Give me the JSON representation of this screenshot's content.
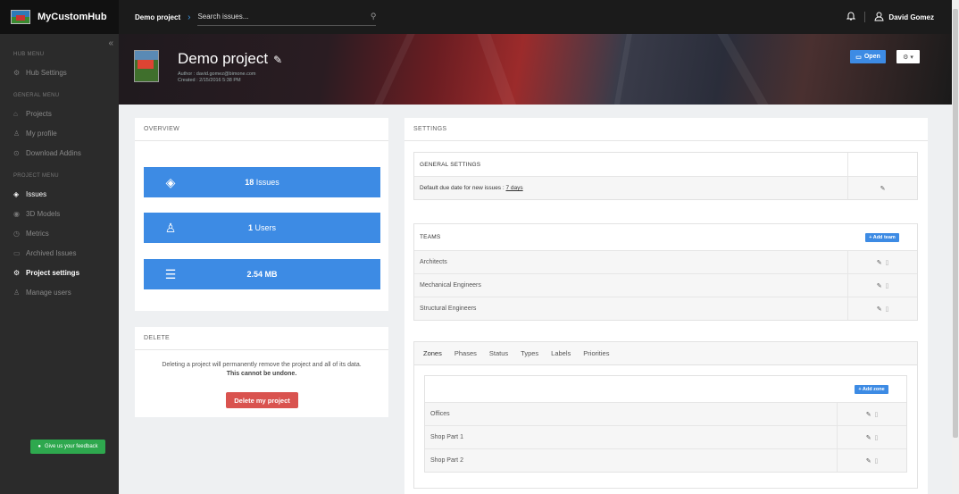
{
  "app": {
    "name": "MyCustomHub"
  },
  "topbar": {
    "breadcrumb": "Demo project",
    "breadcrumb_arrow": "›",
    "search_placeholder": "Search issues...",
    "user_name": "David Gomez"
  },
  "sidebar": {
    "collapse_glyph": "«",
    "sections": [
      {
        "title": "HUB MENU",
        "items": [
          {
            "label": "Hub Settings",
            "icon": "gear-icon",
            "glyph": "⚙",
            "active": false
          }
        ]
      },
      {
        "title": "GENERAL MENU",
        "items": [
          {
            "label": "Projects",
            "icon": "home-icon",
            "glyph": "⌂",
            "active": false
          },
          {
            "label": "My profile",
            "icon": "user-icon",
            "glyph": "♙",
            "active": false
          },
          {
            "label": "Download Addins",
            "icon": "download-icon",
            "glyph": "⊙",
            "active": false
          }
        ]
      },
      {
        "title": "PROJECT MENU",
        "items": [
          {
            "label": "Issues",
            "icon": "layers-icon",
            "glyph": "◈",
            "active": true
          },
          {
            "label": "3D Models",
            "icon": "eye-icon",
            "glyph": "◉",
            "active": false
          },
          {
            "label": "Metrics",
            "icon": "clock-icon",
            "glyph": "◷",
            "active": false
          },
          {
            "label": "Archived Issues",
            "icon": "archive-icon",
            "glyph": "▭",
            "active": false
          },
          {
            "label": "Project settings",
            "icon": "gear-icon",
            "glyph": "⚙",
            "active": true
          },
          {
            "label": "Manage users",
            "icon": "users-icon",
            "glyph": "♙",
            "active": false
          }
        ]
      }
    ],
    "feedback_label": "Give us your feedback"
  },
  "project": {
    "title": "Demo project",
    "author": "Author : david.gomez@bimone.com",
    "created": "Created : 2/15/2016 5:38 PM",
    "open_label": "Open",
    "gear_label": "⚙ ▾"
  },
  "overview": {
    "title": "OVERVIEW",
    "stats": [
      {
        "value": "18",
        "label": "Issues",
        "icon": "layers-icon",
        "glyph": "◈"
      },
      {
        "value": "1",
        "label": "Users",
        "icon": "users-icon",
        "glyph": "♙"
      },
      {
        "value": "2.54 MB",
        "label": "",
        "icon": "database-icon",
        "glyph": "☰"
      }
    ]
  },
  "delete": {
    "title": "DELETE",
    "text": "Deleting a project will permanently remove the project and all of its data.",
    "warning": "This cannot be undone.",
    "button": "Delete my project"
  },
  "settings": {
    "title": "SETTINGS",
    "general": {
      "header": "GENERAL SETTINGS",
      "due_date_text": "Default due date for new issues :",
      "due_date_value": "7 days"
    },
    "teams": {
      "header": "TEAMS",
      "add_label": "+ Add team",
      "rows": [
        "Architects",
        "Mechanical Engineers",
        "Structural Engineers"
      ]
    },
    "zones": {
      "tabs": [
        "Zones",
        "Phases",
        "Status",
        "Types",
        "Labels",
        "Priorities"
      ],
      "add_label": "+ Add zone",
      "rows": [
        "Offices",
        "Shop Part 1",
        "Shop Part 2"
      ]
    }
  },
  "icons": {
    "edit": "✎",
    "delete": "🗑",
    "bell": "🔔",
    "user": "♙",
    "search": "⚲",
    "open": "🗁"
  }
}
